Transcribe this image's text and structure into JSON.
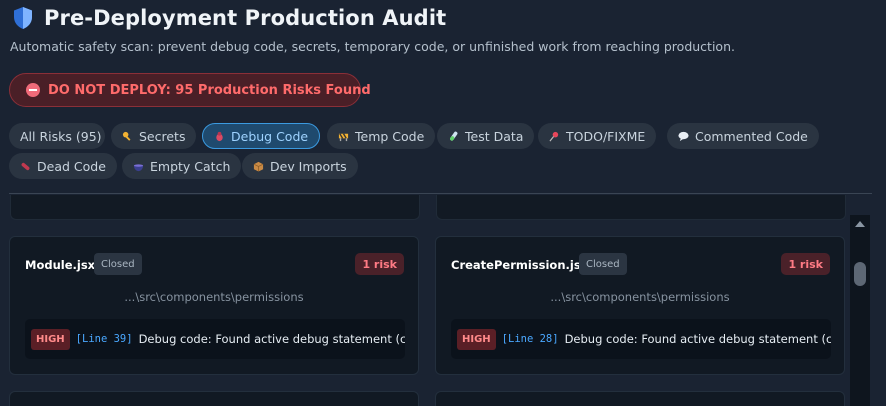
{
  "header": {
    "icon": "shield-icon",
    "title": "Pre-Deployment Production Audit",
    "subtitle": "Automatic safety scan: prevent debug code, secrets, temporary code, or unfinished work from reaching production."
  },
  "alert": {
    "icon": "no-entry-icon",
    "text": "DO NOT DEPLOY: 95 Production Risks Found",
    "color": "#ff6b6b"
  },
  "filters": [
    {
      "label": "All Risks (95)",
      "icon": "",
      "active": false
    },
    {
      "label": "Secrets",
      "icon": "key-icon",
      "active": false
    },
    {
      "label": "Debug Code",
      "icon": "bug-icon",
      "active": true
    },
    {
      "label": "Temp Code",
      "icon": "construction-icon",
      "active": false
    },
    {
      "label": "Test Data",
      "icon": "test-tube-icon",
      "active": false
    },
    {
      "label": "TODO/FIXME",
      "icon": "pushpin-icon",
      "active": false
    },
    {
      "label": "Commented Code",
      "icon": "speech-bubble-icon",
      "active": false
    },
    {
      "label": "Dead Code",
      "icon": "capsule-icon",
      "active": false
    },
    {
      "label": "Empty Catch",
      "icon": "bowl-icon",
      "active": false
    },
    {
      "label": "Dev Imports",
      "icon": "package-icon",
      "active": false
    }
  ],
  "cards": [
    {
      "file": "Module.jsx",
      "status": "Closed",
      "risk_count": "1 risk",
      "path": "...\\src\\components\\permissions",
      "issue": {
        "severity": "HIGH",
        "line": "[Line 39]",
        "message": "Debug code: Found active debug statement (console.log)"
      }
    },
    {
      "file": "CreatePermission.jsx",
      "status": "Closed",
      "risk_count": "1 risk",
      "path": "...\\src\\components\\permissions",
      "issue": {
        "severity": "HIGH",
        "line": "[Line 28]",
        "message": "Debug code: Found active debug statement (console.log)"
      }
    }
  ],
  "colors": {
    "background": "#1a2332",
    "card": "#111923",
    "active_chip": "#1f4a6e",
    "high_severity": "#ff8a8a"
  }
}
